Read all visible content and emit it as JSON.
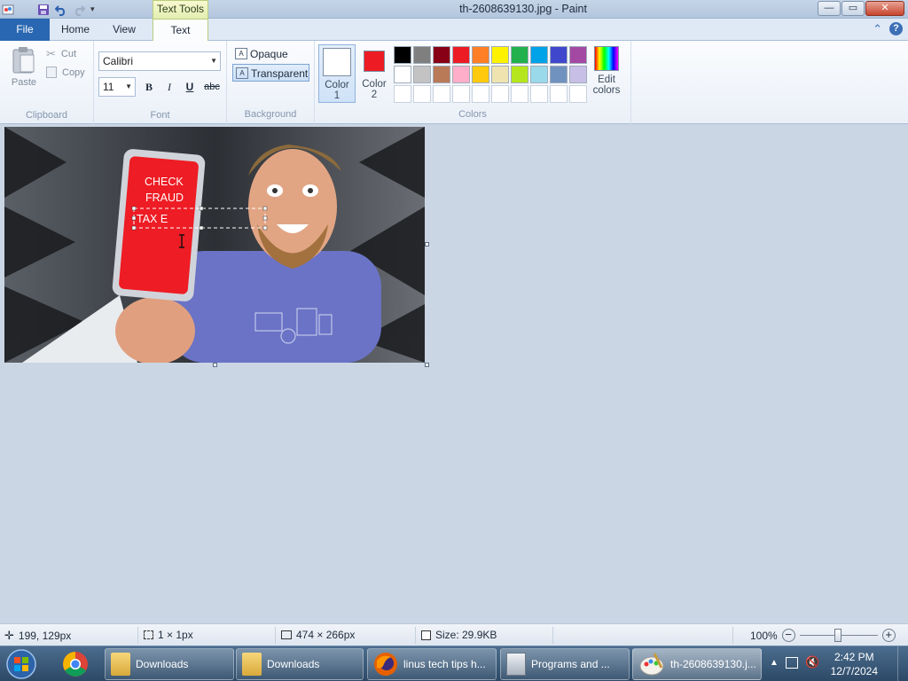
{
  "window": {
    "title": "th-2608639130.jpg - Paint",
    "tool_tab": "Text Tools",
    "minimize": "—",
    "maximize": "▭",
    "close": "✕"
  },
  "tabs": {
    "file": "File",
    "home": "Home",
    "view": "View",
    "text": "Text"
  },
  "clipboard": {
    "paste": "Paste",
    "cut": "Cut",
    "copy": "Copy",
    "group": "Clipboard"
  },
  "font": {
    "family": "Calibri",
    "size": "11",
    "bold": "B",
    "italic": "I",
    "underline": "U",
    "strike": "abc",
    "group": "Font"
  },
  "background": {
    "opaque": "Opaque",
    "transparent": "Transparent",
    "group": "Background",
    "selected": "Transparent"
  },
  "colors": {
    "color1_label": "Color",
    "color1_num": "1",
    "color2_label": "Color",
    "color2_num": "2",
    "color1_value": "#ffffff",
    "color2_value": "#ed1c24",
    "edit_label": "Edit",
    "edit_label2": "colors",
    "group": "Colors",
    "palette_row1": [
      "#000000",
      "#7f7f7f",
      "#880015",
      "#ed1c24",
      "#ff7f27",
      "#fff200",
      "#22b14c",
      "#00a2e8",
      "#3f48cc",
      "#a349a4"
    ],
    "palette_row2": [
      "#ffffff",
      "#c3c3c3",
      "#b97a57",
      "#ffaec9",
      "#ffc90e",
      "#efe4b0",
      "#b5e61d",
      "#99d9ea",
      "#7092be",
      "#c8bfe7"
    ]
  },
  "image": {
    "phone_text_1": "CHECK",
    "phone_text_2": "FRAUD",
    "typing_text": "TAX E"
  },
  "status": {
    "cursor_pos": "199, 129px",
    "selection": "1 × 1px",
    "image_size": "474 × 266px",
    "file_size": "Size: 29.9KB",
    "zoom": "100%",
    "zoom_level": 1.0
  },
  "taskbar": {
    "items": [
      {
        "label": "Downloads"
      },
      {
        "label": "Downloads"
      },
      {
        "label": "linus tech tips h..."
      },
      {
        "label": "Programs and ..."
      },
      {
        "label": "th-2608639130.j..."
      }
    ],
    "time": "2:42 PM",
    "date": "12/7/2024"
  }
}
